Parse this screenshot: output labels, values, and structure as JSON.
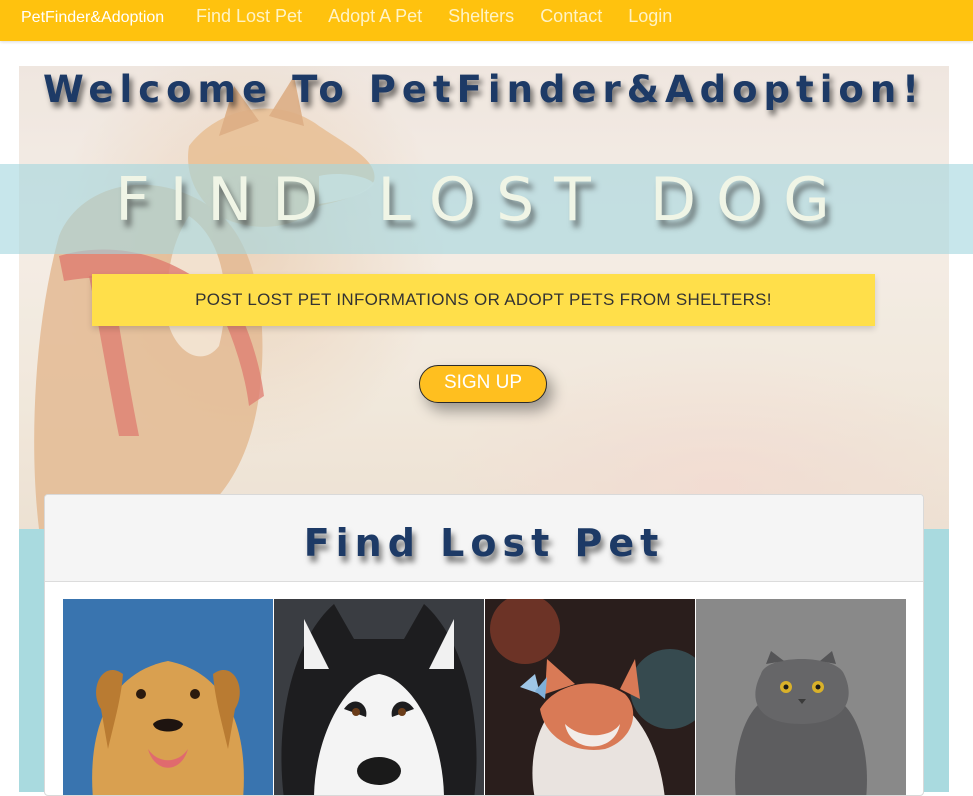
{
  "navbar": {
    "brand": "PetFinder&Adoption",
    "links": [
      "Find Lost Pet",
      "Adopt A Pet",
      "Shelters",
      "Contact",
      "Login"
    ]
  },
  "hero": {
    "title": "Welcome To PetFinder&Adoption!",
    "banner": "FIND LOST DOG",
    "tagline": "POST LOST PET INFORMATIONS OR ADOPT PETS FROM SHELTERS!",
    "signup_label": "SIGN UP"
  },
  "lost_pets": {
    "title": "Find Lost Pet",
    "pets": [
      {
        "icon": "golden-retriever-photo"
      },
      {
        "icon": "husky-photo"
      },
      {
        "icon": "cat-with-butterfly-photo"
      },
      {
        "icon": "gray-cat-photo"
      }
    ]
  },
  "colors": {
    "navbar": "#ffc20e",
    "title": "#1d3a66",
    "tagline_bg": "#ffdf4a",
    "signup_bg": "#ffbf1f",
    "teal": "#a9dadf"
  }
}
